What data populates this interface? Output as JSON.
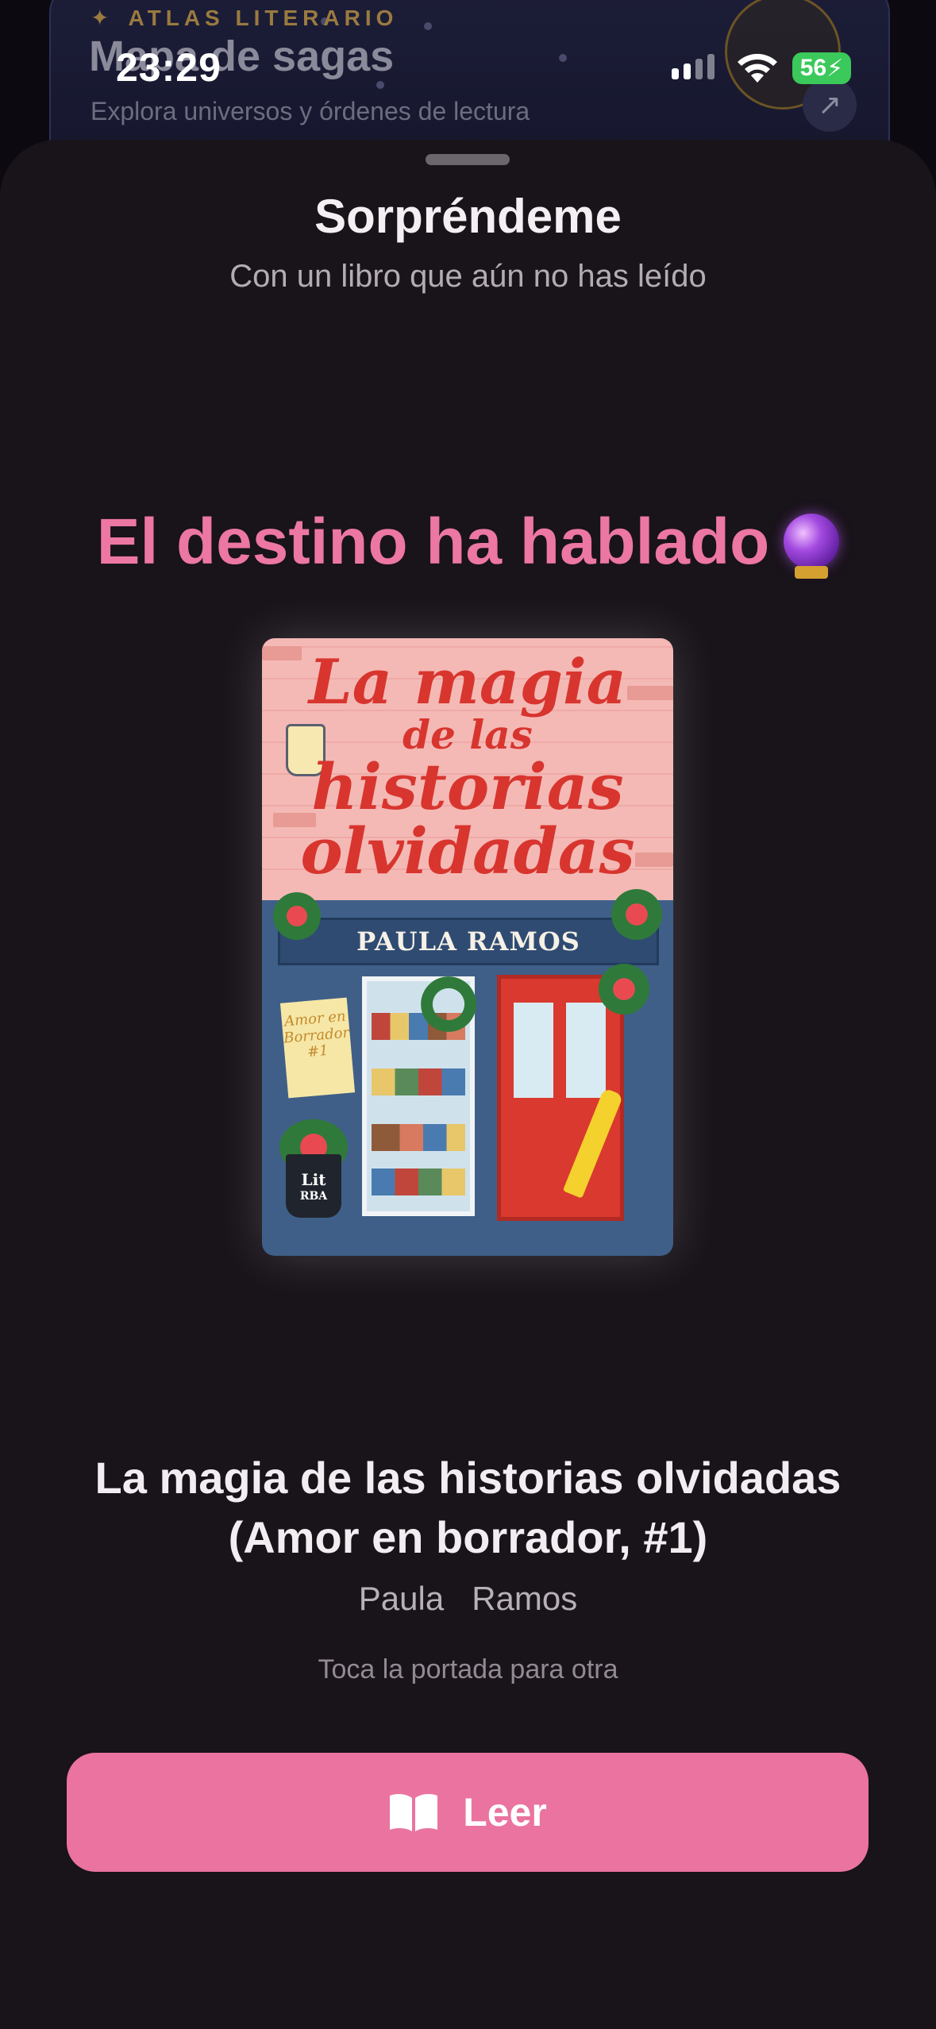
{
  "status_bar": {
    "time": "23:29",
    "battery": "56"
  },
  "background_card": {
    "eyebrow": "ATLAS LITERARIO",
    "title": "Mapa de sagas",
    "subtitle": "Explora universos y órdenes de lectura"
  },
  "sheet": {
    "title": "Sorpréndeme",
    "subtitle": "Con un libro que aún no has leído",
    "headline": "El destino ha hablado",
    "cover": {
      "title_line1": "La magia",
      "title_line2": "de las",
      "title_line3": "historias",
      "title_line4": "olvidadas",
      "author_sign": "PAULA RAMOS",
      "note_text": "Amor en Borrador #1",
      "publisher_top": "Lit",
      "publisher_bottom": "RBA"
    },
    "book_title": "La magia de las historias olvidadas (Amor en borrador, #1)",
    "book_author": "Paula   Ramos",
    "hint": "Toca la portada para otra",
    "read_button_label": "Leer"
  },
  "colors": {
    "accent_pink": "#ea739f",
    "headline_pink": "#ec77a2",
    "sheet_bg": "#19131a",
    "battery_green": "#3ac95a"
  },
  "icons": [
    "signal-icon",
    "wifi-icon",
    "battery-icon",
    "sparkle-icon",
    "arrow-up-right-icon",
    "crystal-ball-icon",
    "book-open-icon"
  ]
}
